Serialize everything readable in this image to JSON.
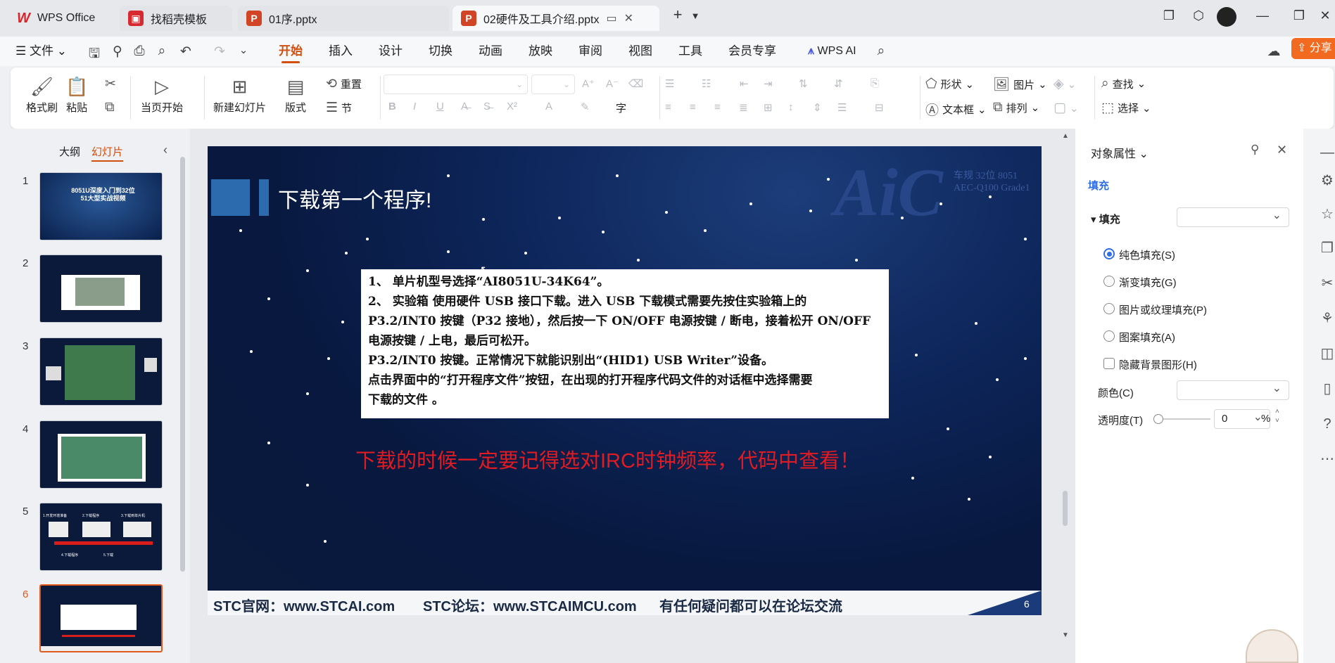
{
  "tabs": [
    {
      "label": "WPS Office"
    },
    {
      "label": "找稻壳模板"
    },
    {
      "label": "01序.pptx"
    },
    {
      "label": "02硬件及工具介绍.pptx"
    }
  ],
  "menu": {
    "file": "文件",
    "items": [
      "开始",
      "插入",
      "设计",
      "切换",
      "动画",
      "放映",
      "审阅",
      "视图",
      "工具",
      "会员专享"
    ],
    "active": "开始",
    "wps_ai": "WPS AI",
    "share": "分享"
  },
  "ribbon": {
    "format_painter": "格式刷",
    "paste": "粘贴",
    "from_current": "当页开始",
    "new_slide": "新建幻灯片",
    "layout": "版式",
    "reset": "重置",
    "section": "节",
    "shape": "形状",
    "picture": "图片",
    "textbox": "文本框",
    "arrange": "排列",
    "find": "查找",
    "select": "选择"
  },
  "left_pane": {
    "tab_outline": "大纲",
    "tab_slides": "幻灯片",
    "active_tab": "幻灯片",
    "slide_numbers": [
      "1",
      "2",
      "3",
      "4",
      "5",
      "6"
    ],
    "selected": "6",
    "thumb1_title": "8051U深度入门到32位51大型实战视频",
    "thumb5_labels": [
      "1.开发环境准备",
      "2.下载程序",
      "3.下载到单片机",
      "4.下载程序",
      "5.下载"
    ]
  },
  "slide": {
    "title": "下载第一个程序!",
    "logo_text": "AiC",
    "logo_sub_1": "车规 32位 8051",
    "logo_sub_2": "AEC-Q100 Grade1",
    "lines": [
      "1、 单片机型号选择“AI8051U-34K64”。",
      "2、 实验箱 使用硬件 USB 接口下载。进入 USB 下载模式需要先按住实验箱上的",
      "P3.2/INT0 按键（P32 接地），然后按一下 ON/OFF 电源按键 / 断电，接着松开 ON/OFF",
      "电源按键 / 上电，最后可松开。",
      "P3.2/INT0 按键。正常情况下就能识别出“(HID1) USB Writer”设备。",
      "点击界面中的“打开程序文件”按钮，在出现的打开程序代码文件的对话框中选择需要",
      "下载的文件 。"
    ],
    "red_note": "下载的时候一定要记得选对IRC时钟频率，代码中查看！",
    "footer_site": "STC官网：www.STCAI.com",
    "footer_forum": "STC论坛：www.STCAIMCU.com",
    "footer_note": "有任何疑问都可以在论坛交流",
    "page_number": "6"
  },
  "props": {
    "title": "对象属性",
    "tab_fill": "填充",
    "section_fill": "填充",
    "opt_solid": "纯色填充(S)",
    "opt_gradient": "渐变填充(G)",
    "opt_picture": "图片或纹理填充(P)",
    "opt_pattern": "图案填充(A)",
    "hide_bg": "隐藏背景图形(H)",
    "color_label": "颜色(C)",
    "transparency_label": "透明度(T)",
    "transparency_value": "0",
    "transparency_unit": "%"
  },
  "colors": {
    "accent": "#d24e0e",
    "share_bg": "#f26a1f",
    "slide_bg": "#0d2559",
    "title_block": "#2c6cae",
    "red_note": "#e11b22",
    "radio_on": "#2f6ee8"
  }
}
